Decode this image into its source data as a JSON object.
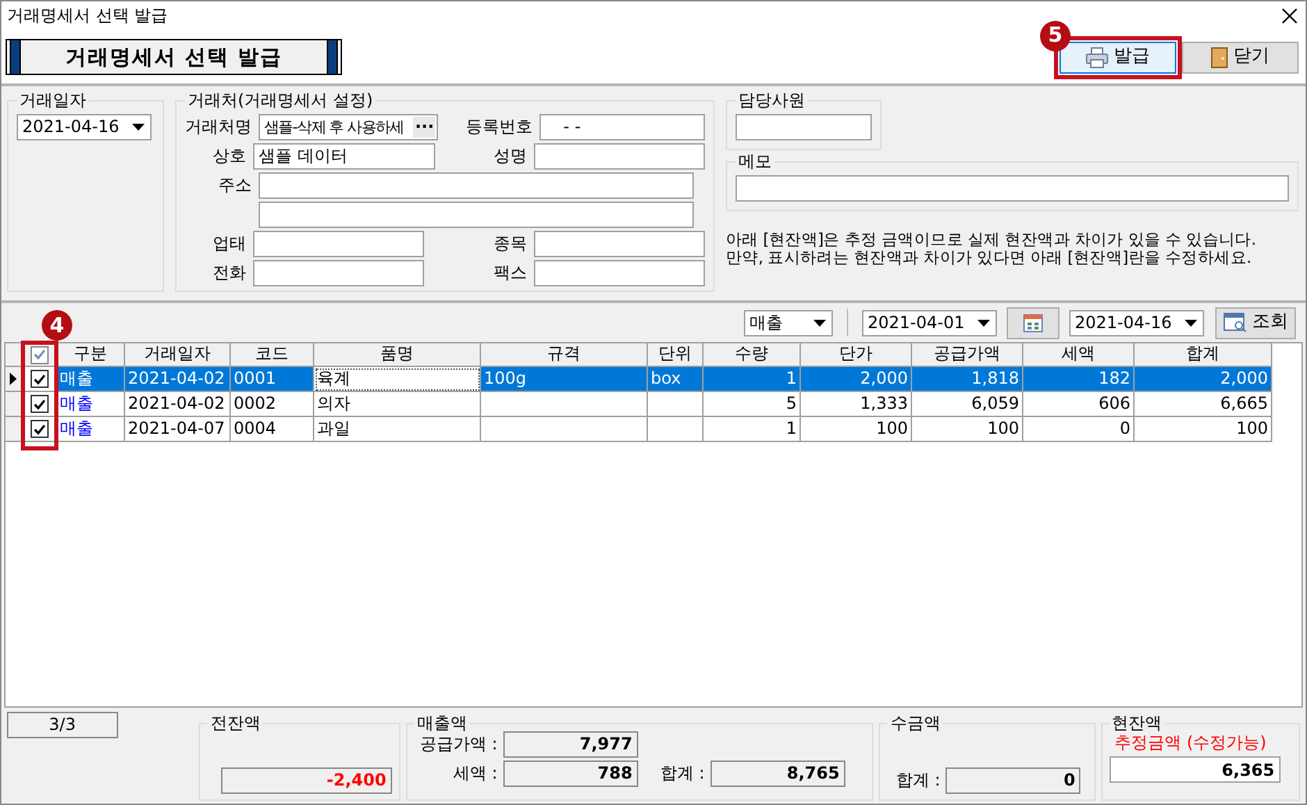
{
  "window": {
    "title": "거래명세서 선택 발급"
  },
  "banner": "거래명세서 선택 발급",
  "buttons": [
    {
      "label": "발급",
      "kind": "print",
      "focused": true,
      "annotation": "5"
    },
    {
      "label": "닫기",
      "kind": "close",
      "focused": false
    }
  ],
  "trade_date": {
    "legend": "거래일자",
    "value": "2021-04-16"
  },
  "customer": {
    "legend": "거래처(거래명세서 설정)",
    "rows": [
      [
        {
          "label": "거래처명",
          "value": "샘플-삭제 후 사용하세",
          "button": "···"
        },
        {
          "label": "등록번호",
          "value": "-  -"
        }
      ],
      [
        {
          "label": "상호",
          "value": "샘플 데이터"
        },
        {
          "label": "성명"
        }
      ],
      [
        {
          "label": "주소"
        }
      ],
      [
        {}
      ],
      [
        {
          "label": "업태"
        },
        {
          "label": "종목"
        }
      ],
      [
        {
          "label": "전화"
        },
        {
          "label": "팩스"
        }
      ]
    ]
  },
  "staff": {
    "legend": "담당사원"
  },
  "memo": {
    "legend": "메모"
  },
  "notice": [
    "아래 [현잔액]은 추정 금액이므로 실제 현잔액과 차이가 있을 수 있습니다.",
    "만약, 표시하려는 현잔액과 차이가 있다면 아래 [현잔액]란을 수정하세요."
  ],
  "filter": {
    "type": "매출",
    "from": "2021-04-01",
    "to": "2021-04-16",
    "search": "조회"
  },
  "table": {
    "header_checked": true,
    "check_annotation": "4",
    "columns": [
      {
        "label": "구분"
      },
      {
        "label": "거래일자"
      },
      {
        "label": "코드"
      },
      {
        "label": "품명"
      },
      {
        "label": "규격"
      },
      {
        "label": "단위"
      },
      {
        "label": "수량",
        "numeric": true
      },
      {
        "label": "단가",
        "numeric": true
      },
      {
        "label": "공급가액",
        "numeric": true
      },
      {
        "label": "세액",
        "numeric": true
      },
      {
        "label": "합계",
        "numeric": true
      }
    ],
    "rows": [
      {
        "current": true,
        "selected": true,
        "checked": true,
        "cells": [
          "매출",
          "2021-04-02",
          "0001",
          "육계",
          "100g",
          "box",
          "1",
          "2,000",
          "1,818",
          "182",
          "2,000"
        ]
      },
      {
        "current": false,
        "selected": false,
        "checked": true,
        "cells": [
          "매출",
          "2021-04-02",
          "0002",
          "의자",
          "",
          "",
          "5",
          "1,333",
          "6,059",
          "606",
          "6,665"
        ]
      },
      {
        "current": false,
        "selected": false,
        "checked": true,
        "cells": [
          "매출",
          "2021-04-07",
          "0004",
          "과일",
          "",
          "",
          "1",
          "100",
          "100",
          "0",
          "100"
        ]
      }
    ]
  },
  "footer": {
    "count": "3/3",
    "prev_balance": {
      "legend": "전잔액",
      "value": "-2,400",
      "negative": true
    },
    "sales": {
      "legend": "매출액",
      "supply_label": "공급가액 :",
      "supply": "7,977",
      "tax_label": "세액 :",
      "tax": "788",
      "total_label": "합계 :",
      "total": "8,765"
    },
    "collection": {
      "legend": "수금액",
      "total_label": "합계 :",
      "total": "0"
    },
    "current_balance": {
      "legend": "현잔액",
      "note": "추정금액 (수정가능)",
      "value": "6,365"
    }
  }
}
